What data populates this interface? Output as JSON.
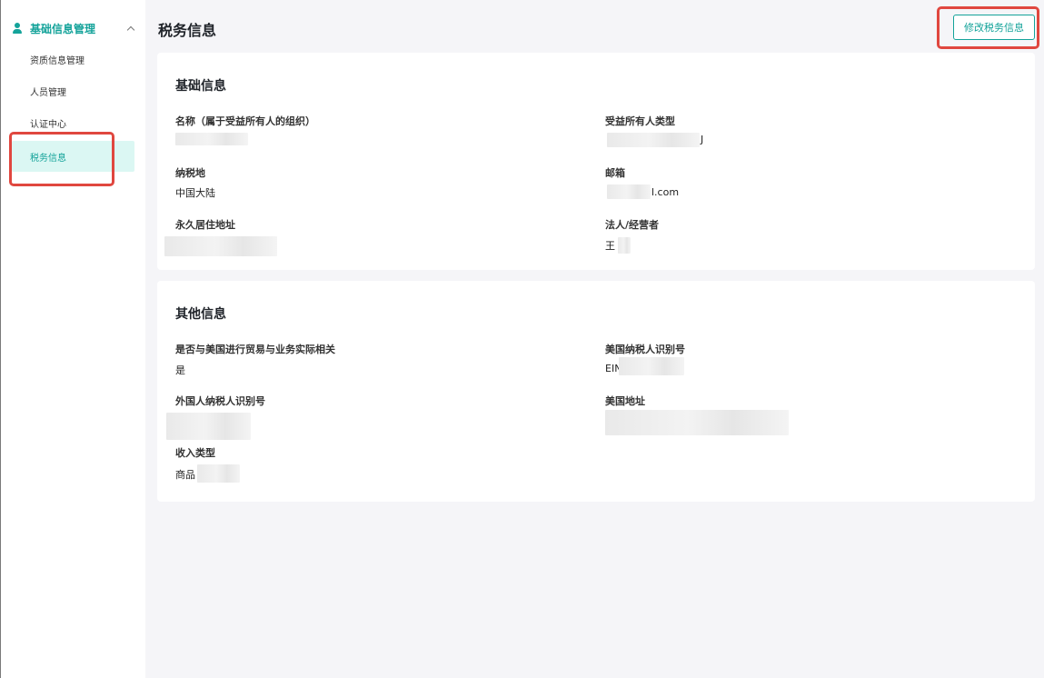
{
  "sidebar": {
    "group_label": "基础信息管理",
    "items": [
      {
        "label": "资质信息管理"
      },
      {
        "label": "人员管理"
      },
      {
        "label": "认证中心"
      },
      {
        "label": "税务信息"
      }
    ]
  },
  "page": {
    "title": "税务信息",
    "edit_button": "修改税务信息"
  },
  "basic": {
    "title": "基础信息",
    "fields": [
      {
        "label": "名称（属于受益所有人的组织）",
        "value": ""
      },
      {
        "label": "受益所有人类型",
        "value": "J"
      },
      {
        "label": "纳税地",
        "value": "中国大陆"
      },
      {
        "label": "邮箱",
        "value": "l.com"
      },
      {
        "label": "永久居住地址",
        "value": ""
      },
      {
        "label": "法人/经营者",
        "value": "王"
      }
    ]
  },
  "other": {
    "title": "其他信息",
    "fields": [
      {
        "label": "是否与美国进行贸易与业务实际相关",
        "value": "是"
      },
      {
        "label": "美国纳税人识别号",
        "value": "EIN"
      },
      {
        "label": "外国人纳税人识别号",
        "value": ""
      },
      {
        "label": "美国地址",
        "value": ""
      },
      {
        "label": "收入类型",
        "value": "商品"
      }
    ]
  },
  "colors": {
    "accent": "#14a39a",
    "active_bg": "#dbf7f3",
    "highlight": "#e0473f",
    "page_bg": "#f5f5f8"
  },
  "icons": {
    "group": "user-icon",
    "expand": "chevron-up-icon"
  }
}
